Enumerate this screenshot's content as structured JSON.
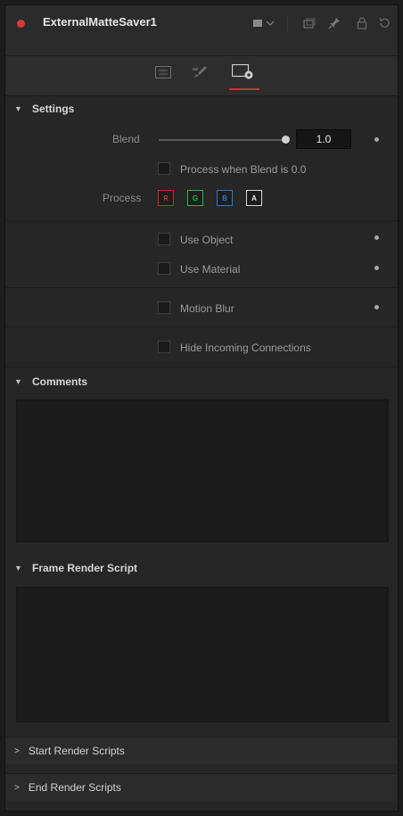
{
  "header": {
    "title": "ExternalMatteSaver1",
    "icons": [
      "color-square-icon",
      "dropdown-chevron-icon",
      "versions-icon",
      "pin-icon",
      "lock-icon",
      "reset-icon"
    ]
  },
  "tabs": [
    {
      "name": "controls-tab",
      "icon": "sliders-icon"
    },
    {
      "name": "modifiers-tab",
      "icon": "brush-icon"
    },
    {
      "name": "settings-tab",
      "icon": "gear-icon",
      "active": true
    }
  ],
  "settings": {
    "section_label": "Settings",
    "blend_label": "Blend",
    "blend_value": "1.0",
    "blend_fraction": 1.0,
    "process_when_blend_label": "Process when Blend is 0.0",
    "process_label": "Process",
    "channels": [
      {
        "letter": "R",
        "color": "#c22b2b"
      },
      {
        "letter": "G",
        "color": "#2fb24a"
      },
      {
        "letter": "B",
        "color": "#2f78c8"
      },
      {
        "letter": "A",
        "color": "#d8d8d8"
      }
    ],
    "use_object_label": "Use Object",
    "use_material_label": "Use Material",
    "motion_blur_label": "Motion Blur",
    "hide_incoming_label": "Hide Incoming Connections"
  },
  "comments": {
    "section_label": "Comments",
    "text": ""
  },
  "frame_render_script": {
    "section_label": "Frame Render Script",
    "text": ""
  },
  "start_render_scripts": {
    "label": "Start Render Scripts"
  },
  "end_render_scripts": {
    "label": "End Render Scripts"
  },
  "colors": {
    "accent": "#c8333a",
    "node_dot": "#d63a3a"
  }
}
